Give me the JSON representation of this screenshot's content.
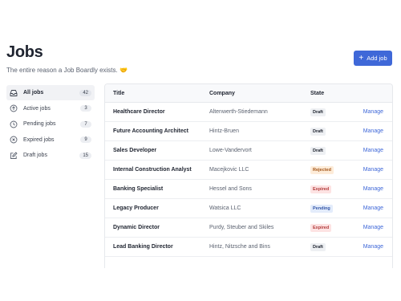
{
  "header": {
    "title": "Jobs",
    "subtitle": "The entire reason a Job Boardly exists. 🤝"
  },
  "actions": {
    "add_job_label": "Add job"
  },
  "sidebar": {
    "items": [
      {
        "label": "All jobs",
        "count": "42",
        "icon": "inbox-icon"
      },
      {
        "label": "Active jobs",
        "count": "3",
        "icon": "arrow-up-circle-icon"
      },
      {
        "label": "Pending jobs",
        "count": "7",
        "icon": "clock-icon"
      },
      {
        "label": "Expired jobs",
        "count": "9",
        "icon": "x-circle-icon"
      },
      {
        "label": "Draft jobs",
        "count": "15",
        "icon": "pencil-square-icon"
      }
    ]
  },
  "table": {
    "columns": {
      "title": "Title",
      "company": "Company",
      "state": "State"
    },
    "rows": [
      {
        "title": "Healthcare Director",
        "company": "Altenwerth-Stiedemann",
        "state": "Draft",
        "action": "Manage"
      },
      {
        "title": "Future Accounting Architect",
        "company": "Hintz-Bruen",
        "state": "Draft",
        "action": "Manage"
      },
      {
        "title": "Sales Developer",
        "company": "Lowe-Vandervort",
        "state": "Draft",
        "action": "Manage"
      },
      {
        "title": "Internal Construction Analyst",
        "company": "Macejkovic LLC",
        "state": "Rejected",
        "action": "Manage"
      },
      {
        "title": "Banking Specialist",
        "company": "Hessel and Sons",
        "state": "Expired",
        "action": "Manage"
      },
      {
        "title": "Legacy Producer",
        "company": "Watsica LLC",
        "state": "Pending",
        "action": "Manage"
      },
      {
        "title": "Dynamic Director",
        "company": "Purdy, Steuber and Skiles",
        "state": "Expired",
        "action": "Manage"
      },
      {
        "title": "Lead Banking Director",
        "company": "Hintz, Nitzsche and Bins",
        "state": "Draft",
        "action": "Manage"
      }
    ]
  },
  "colors": {
    "accent": "#3f68d8",
    "rejected": "#a4561a",
    "expired": "#b23a3a",
    "pending": "#3456a8"
  }
}
